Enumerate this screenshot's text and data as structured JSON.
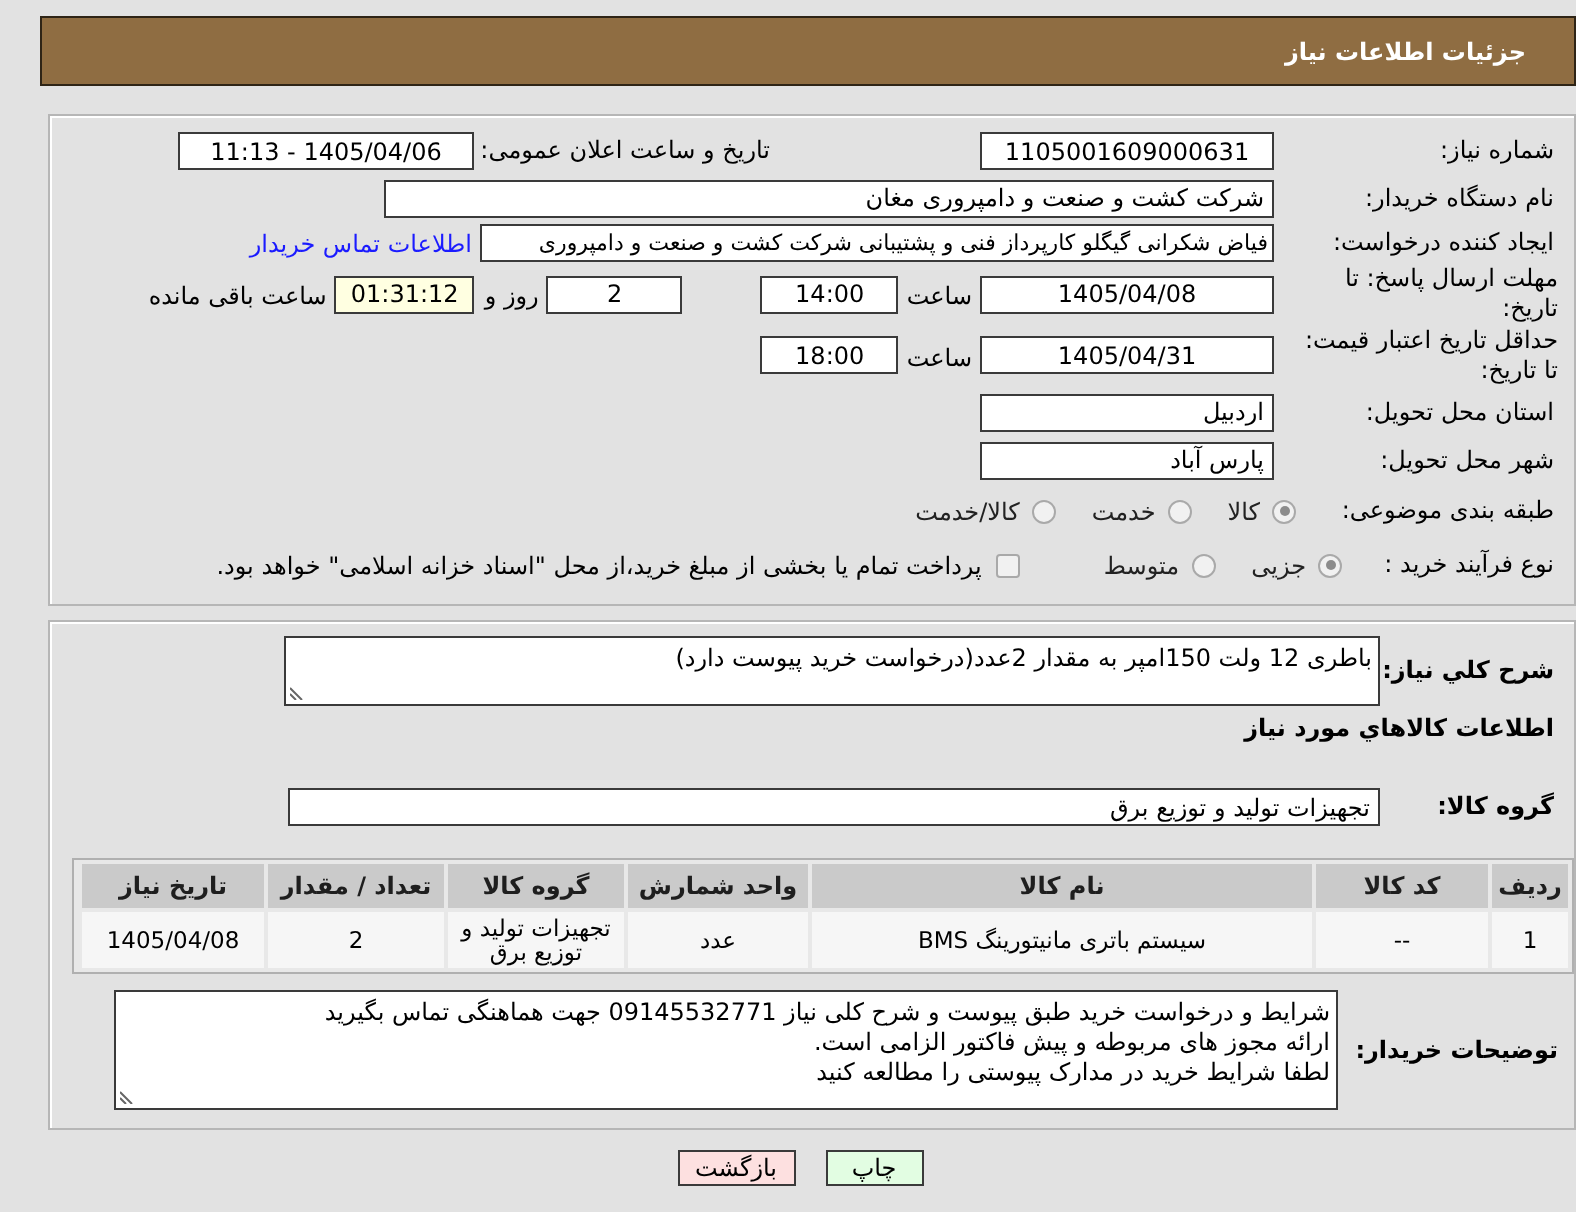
{
  "header": {
    "title": "جزئیات اطلاعات نیاز"
  },
  "need_number": {
    "label": "شماره نیاز:",
    "value": "1105001609000631"
  },
  "announce": {
    "label": "تاریخ و ساعت اعلان عمومی:",
    "value": "1405/04/06 - 11:13"
  },
  "buyer_org": {
    "label": "نام دستگاه خریدار:",
    "value": "شرکت کشت و صنعت و دامپروری مغان"
  },
  "creator": {
    "label": "ایجاد کننده درخواست:",
    "value": "فیاض شکرانی گیگلو کارپرداز فنی و پشتیبانی شرکت کشت و صنعت و دامپروری",
    "link": "اطلاعات تماس خریدار"
  },
  "deadline": {
    "label": "مهلت ارسال پاسخ: تا تاریخ:",
    "date": "1405/04/08",
    "time_label": "ساعت",
    "time": "14:00",
    "days": "2",
    "days_label": "روز و",
    "remaining": "01:31:12",
    "remaining_label": "ساعت باقی مانده"
  },
  "validity": {
    "label": "حداقل تاریخ اعتبار قیمت: تا تاریخ:",
    "date": "1405/04/31",
    "time_label": "ساعت",
    "time": "18:00"
  },
  "province": {
    "label": "استان محل تحویل:",
    "value": "اردبیل"
  },
  "city": {
    "label": "شهر محل تحویل:",
    "value": "پارس آباد"
  },
  "category": {
    "label": "طبقه بندی موضوعی:",
    "options": [
      {
        "label": "کالا",
        "selected": true
      },
      {
        "label": "خدمت",
        "selected": false
      },
      {
        "label": "کالا/خدمت",
        "selected": false
      }
    ]
  },
  "process": {
    "label": "نوع فرآیند خرید :",
    "options": [
      {
        "label": "جزیی",
        "selected": true
      },
      {
        "label": "متوسط",
        "selected": false
      }
    ],
    "treasury": {
      "label": "پرداخت تمام یا بخشی از مبلغ خرید،از محل \"اسناد خزانه اسلامی\" خواهد بود.",
      "checked": false
    }
  },
  "description": {
    "label": "شرح کلي نياز:",
    "value": "باطری 12 ولت 150امپر به مقدار 2عدد(درخواست خرید پیوست دارد)"
  },
  "goods_title": "اطلاعات کالاهاي مورد نياز",
  "goods_group": {
    "label": "گروه کالا:",
    "value": "تجهیزات تولید و توزیع برق"
  },
  "table": {
    "columns": [
      "ردیف",
      "کد کالا",
      "نام کالا",
      "واحد شمارش",
      "گروه کالا",
      "تعداد / مقدار",
      "تاریخ نیاز"
    ],
    "rows": [
      [
        "1",
        "--",
        "سیستم باتری مانیتورینگ BMS",
        "عدد",
        "تجهیزات تولید و توزیع برق",
        "2",
        "1405/04/08"
      ]
    ]
  },
  "buyer_notes": {
    "label": "توضیحات خریدار:",
    "lines": [
      "شرایط و درخواست خرید طبق پیوست و شرح کلی نیاز 09145532771 جهت هماهنگی تماس بگیرید",
      "ارائه مجوز های مربوطه و پیش فاکتور الزامی است.",
      "لطفا شرایط خرید در مدارک پیوستی را مطالعه کنید"
    ]
  },
  "buttons": [
    {
      "kind": "print",
      "label": "چاپ"
    },
    {
      "kind": "back",
      "label": "بازگشت"
    }
  ]
}
